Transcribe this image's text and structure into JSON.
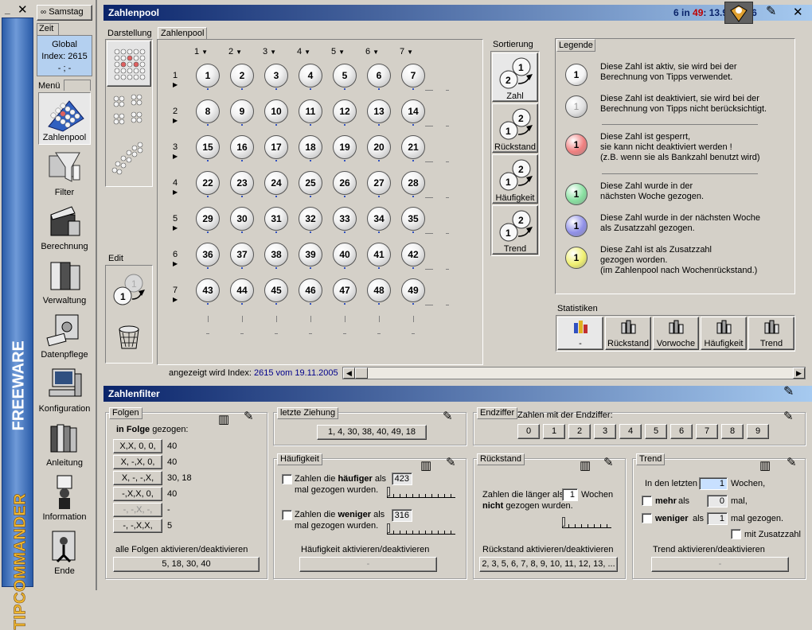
{
  "sidebar": {
    "brand_main": "TIPCOMMANDER",
    "brand_sub": "FREEWARE",
    "day_button": "Samstag",
    "zeit_tab": "Zeit",
    "zeit_line1": "Global",
    "zeit_line2": "Index: 2615",
    "zeit_line3": "- ; -",
    "menu_label": "Menü",
    "items": [
      {
        "label": "Zahlenpool",
        "icon": "balls-icon"
      },
      {
        "label": "Filter",
        "icon": "funnel-icon"
      },
      {
        "label": "Berechnung",
        "icon": "clapper-icon"
      },
      {
        "label": "Verwaltung",
        "icon": "binders-icon"
      },
      {
        "label": "Datenpflege",
        "icon": "safe-icon"
      },
      {
        "label": "Konfiguration",
        "icon": "computer-icon"
      },
      {
        "label": "Anleitung",
        "icon": "books-icon"
      },
      {
        "label": "Information",
        "icon": "info-person-icon"
      },
      {
        "label": "Ende",
        "icon": "exit-icon"
      }
    ]
  },
  "zahlenpool": {
    "title": "Zahlenpool",
    "ticker_prefix": "6 in ",
    "ticker_red": "49",
    "ticker_rest": ": 13.983.816",
    "darstellung_label": "Darstellung",
    "edit_label": "Edit",
    "pool_tab": "Zahlenpool",
    "col_headers": [
      "1",
      "2",
      "3",
      "4",
      "5",
      "6",
      "7"
    ],
    "row_headers": [
      "1",
      "2",
      "3",
      "4",
      "5",
      "6",
      "7"
    ],
    "numbers": [
      [
        "1",
        "2",
        "3",
        "4",
        "5",
        "6",
        "7"
      ],
      [
        "8",
        "9",
        "10",
        "11",
        "12",
        "13",
        "14"
      ],
      [
        "15",
        "16",
        "17",
        "18",
        "19",
        "20",
        "21"
      ],
      [
        "22",
        "23",
        "24",
        "25",
        "26",
        "27",
        "28"
      ],
      [
        "29",
        "30",
        "31",
        "32",
        "33",
        "34",
        "35"
      ],
      [
        "36",
        "37",
        "38",
        "39",
        "40",
        "41",
        "42"
      ],
      [
        "43",
        "44",
        "45",
        "46",
        "47",
        "48",
        "49"
      ]
    ],
    "sortierung_label": "Sortierung",
    "sort_buttons": [
      "Zahl",
      "Rückstand",
      "Häufigkeit",
      "Trend"
    ],
    "legende_label": "Legende",
    "legend": [
      {
        "ball": "1",
        "color": "#f4f4f4",
        "text1": "Diese Zahl ist aktiv, sie wird bei der",
        "text2": "Berechnung von Tipps verwendet.",
        "text3": ""
      },
      {
        "ball": "1",
        "color": "#e0e0e0",
        "text1": "Diese Zahl ist deaktiviert, sie wird bei der",
        "text2": "Berechnung von Tipps nicht berücksichtigt.",
        "text3": ""
      },
      {
        "ball": "1",
        "color": "#f08080",
        "text1": "Diese Zahl ist gesperrt,",
        "text2": "sie kann nicht deaktiviert werden !",
        "text3": "(z.B. wenn sie als Bankzahl benutzt wird)"
      },
      {
        "ball": "1",
        "color": "#88e0a0",
        "text1": "Diese Zahl wurde in der",
        "text2": "nächsten Woche gezogen.",
        "text3": ""
      },
      {
        "ball": "1",
        "color": "#9090e8",
        "text1": "Diese Zahl wurde in der nächsten Woche",
        "text2": "als Zusatzzahl gezogen.",
        "text3": ""
      },
      {
        "ball": "1",
        "color": "#f0f070",
        "text1": "Diese Zahl ist als Zusatzzahl",
        "text2": "gezogen worden.",
        "text3": "(im Zahlenpool nach Wochenrückstand.)"
      }
    ],
    "statistiken_label": "Statistiken",
    "stat_buttons": [
      "-",
      "Rückstand",
      "Vorwoche",
      "Häufigkeit",
      "Trend"
    ],
    "index_prefix": "angezeigt wird Index: ",
    "index_value": "2615 vom 19.11.2005"
  },
  "filter": {
    "title": "Zahlenfilter",
    "folgen_label": "Folgen",
    "in_folge_bold": "in Folge",
    "in_folge_rest": " gezogen:",
    "folgen": [
      {
        "pattern": "X,X, 0, 0,",
        "value": "40",
        "enabled": true
      },
      {
        "pattern": "X, -,X, 0,",
        "value": "40",
        "enabled": true
      },
      {
        "pattern": "X, -, -,X,",
        "value": "30, 18",
        "enabled": true
      },
      {
        "pattern": "-,X,X, 0,",
        "value": "40",
        "enabled": true
      },
      {
        "pattern": "-, -,X, -,",
        "value": "-",
        "enabled": false
      },
      {
        "pattern": "-, -,X,X,",
        "value": "5",
        "enabled": true
      }
    ],
    "folgen_all_label": "alle Folgen aktivieren/deaktivieren",
    "folgen_all_value": "5, 18, 30, 40",
    "letzte_label": "letzte Ziehung",
    "letzte_value": "1, 4, 30, 38, 40, 49,  18",
    "endziffer_label": "Endziffer",
    "endziffer_text": "Zahlen mit der Endziffer:",
    "digits": [
      "0",
      "1",
      "2",
      "3",
      "4",
      "5",
      "6",
      "7",
      "8",
      "9"
    ],
    "haeufigkeit_label": "Häufigkeit",
    "haeuf_more_a": "Zahlen die ",
    "haeuf_more_b": "häufiger",
    "haeuf_more_c": " als",
    "haeuf_more_line2": "mal gezogen wurden.",
    "haeuf_more_value": "423",
    "haeuf_less_a": "Zahlen die ",
    "haeuf_less_b": "weniger",
    "haeuf_less_c": " als",
    "haeuf_less_line2": "mal gezogen wurden.",
    "haeuf_less_value": "316",
    "haeuf_all_label": "Häufigkeit aktivieren/deaktivieren",
    "haeuf_all_value": "-",
    "rueckstand_label": "Rückstand",
    "rueck_line1": "Zahlen die länger als",
    "rueck_value": "1",
    "rueck_line1b": "Wochen",
    "rueck_line2_bold": "nicht",
    "rueck_line2_rest": " gezogen wurden.",
    "rueck_all_label": "Rückstand aktivieren/deaktivieren",
    "rueck_all_value": "2, 3, 5, 6, 7, 8, 9, 10, 11, 12, 13, ...",
    "trend_label": "Trend",
    "trend_line1": "In den letzten",
    "trend_weeks": "1",
    "trend_line1b": "Wochen,",
    "trend_mehr": "mehr",
    "trend_als1": "als",
    "trend_mehr_value": "0",
    "trend_mal": "mal,",
    "trend_weniger": "weniger",
    "trend_als2": "als",
    "trend_weniger_value": "1",
    "trend_mal_gezogen": "mal gezogen.",
    "trend_zusatz": "mit Zusatzzahl",
    "trend_all_label": "Trend aktivieren/deaktivieren",
    "trend_all_value": "-"
  }
}
